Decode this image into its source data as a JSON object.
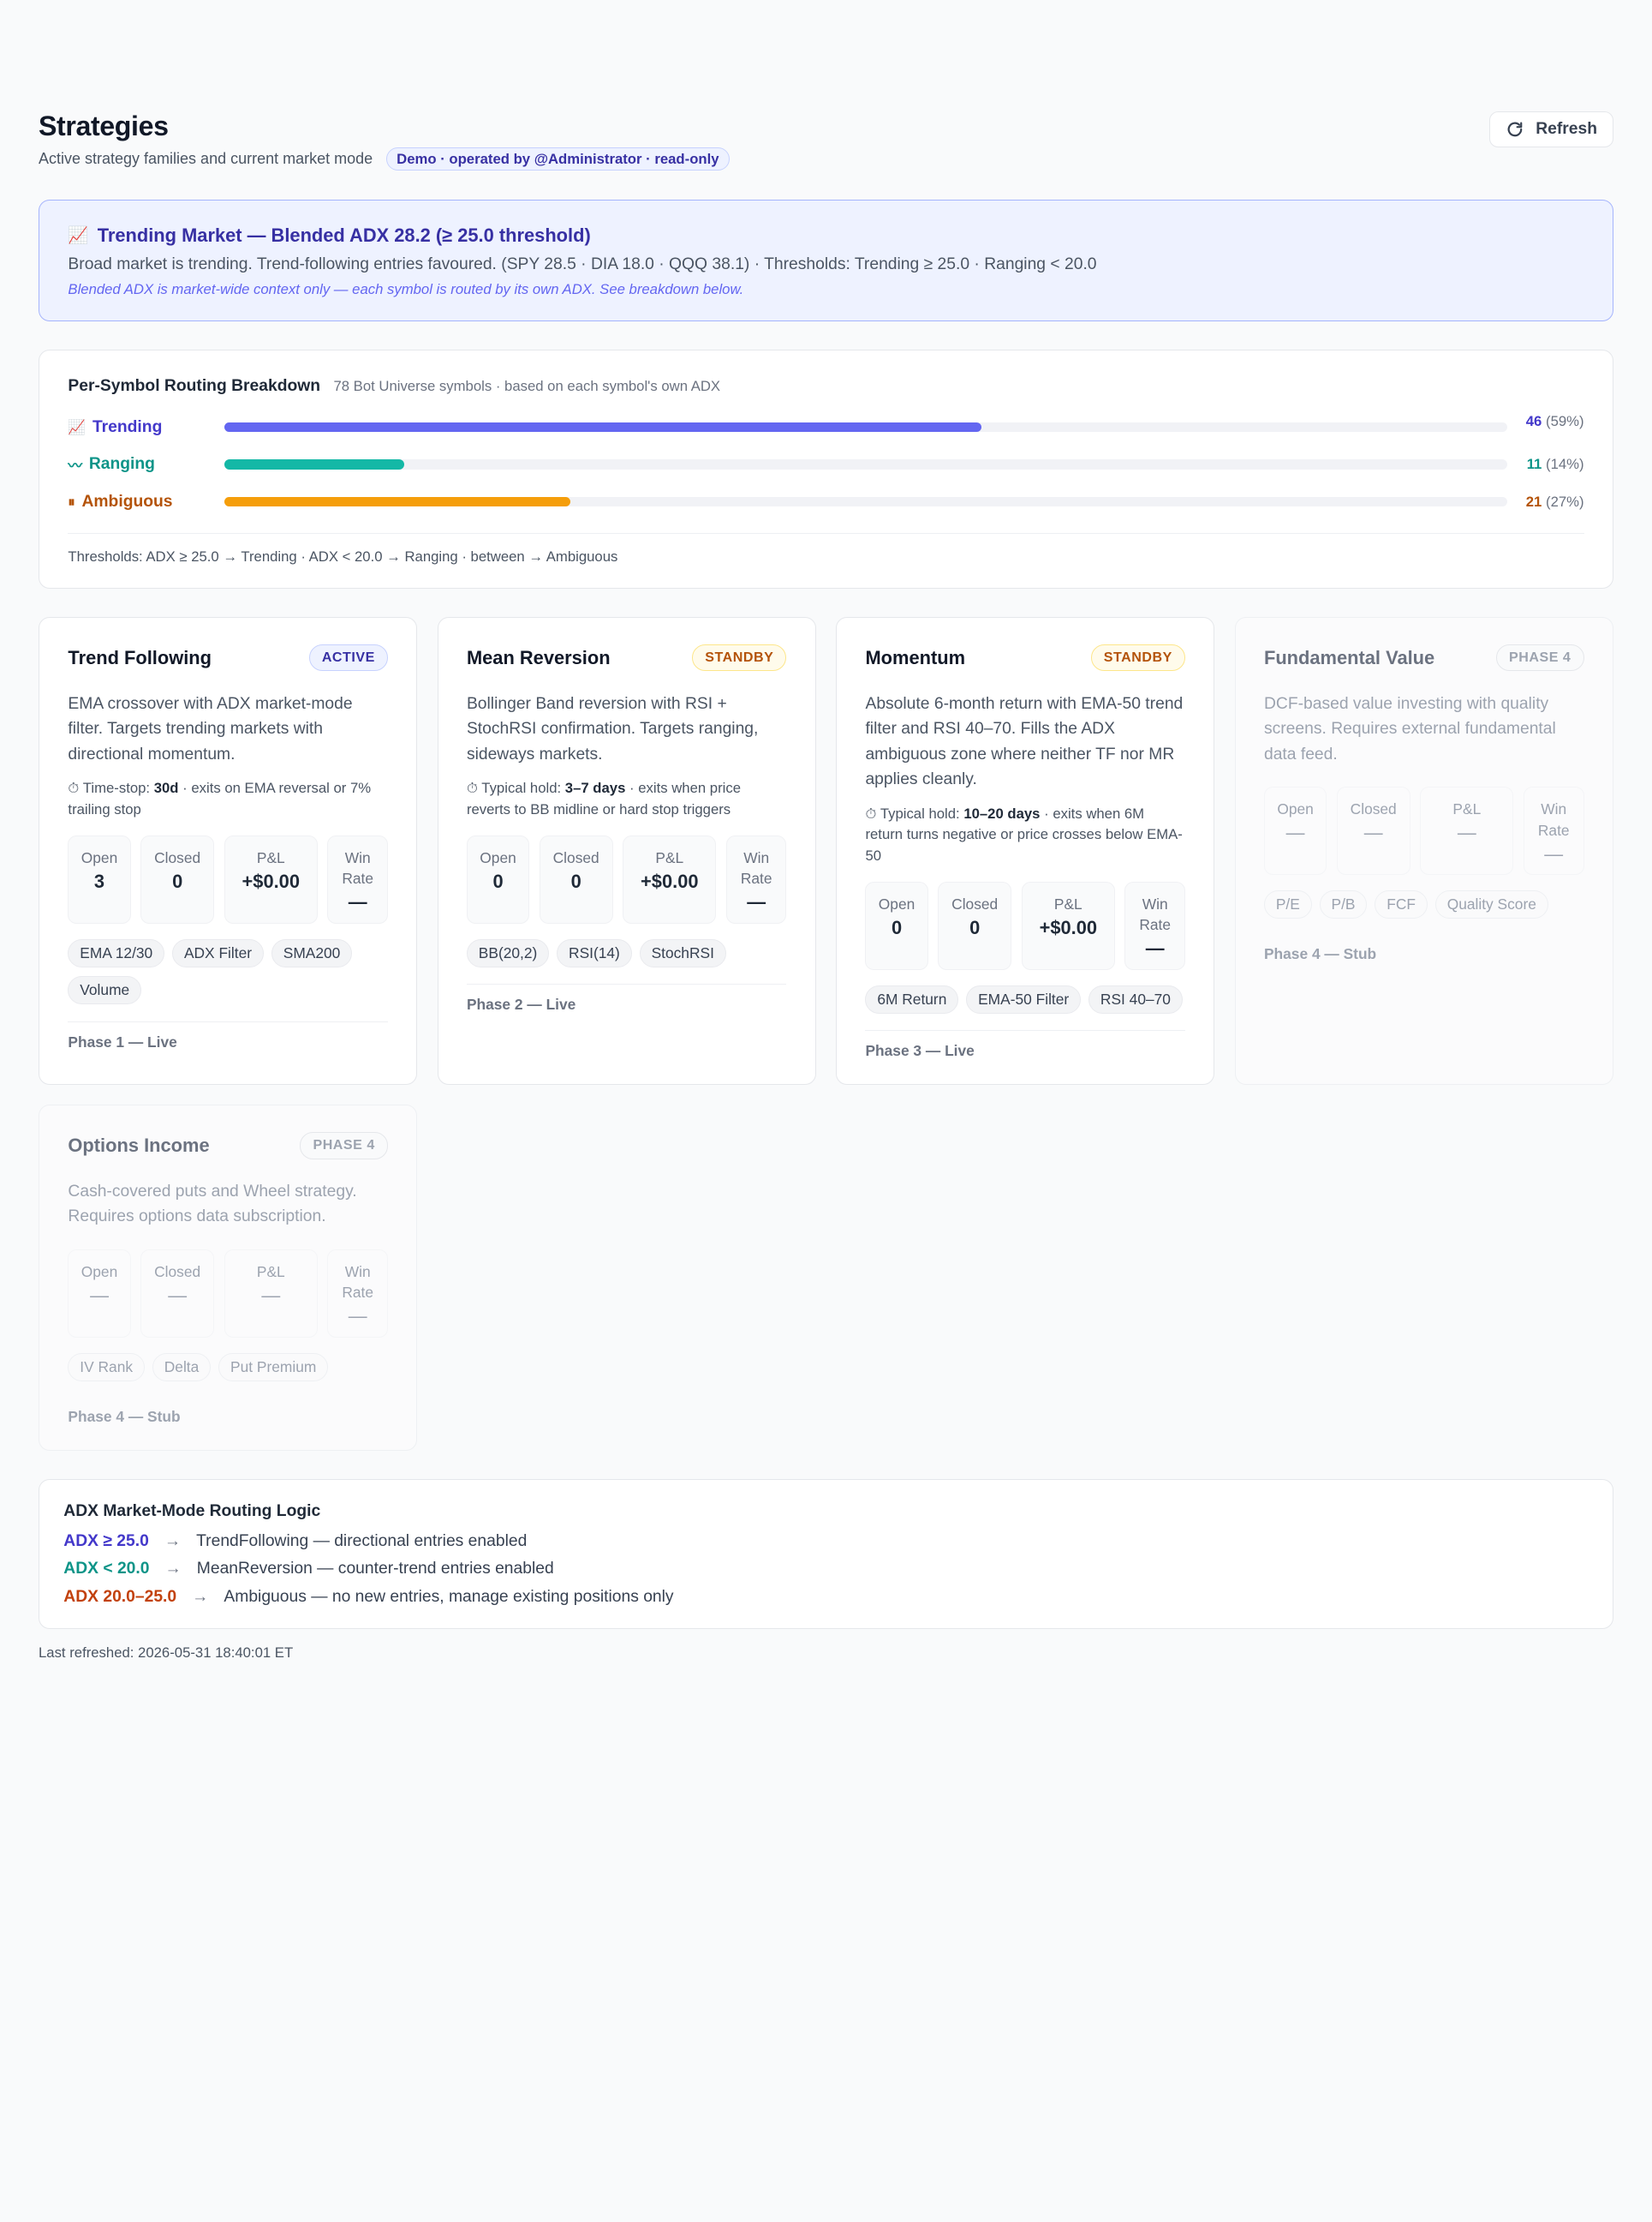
{
  "header": {
    "title": "Strategies",
    "subtitle": "Active strategy families and current market mode",
    "demo_badge": "Demo · operated by @Administrator · read-only",
    "refresh_label": "Refresh"
  },
  "market_banner": {
    "icon": "chart-increasing-icon",
    "title": "Trending Market — Blended ADX 28.2 (≥ 25.0 threshold)",
    "description": "Broad market is trending. Trend-following entries favoured. (SPY 28.5 · DIA 18.0 · QQQ 38.1) · Thresholds: Trending ≥ 25.0 · Ranging < 20.0",
    "note": "Blended ADX is market-wide context only — each symbol is routed by its own ADX. See breakdown below."
  },
  "breakdown": {
    "title": "Per-Symbol Routing Breakdown",
    "subtitle": "78 Bot Universe symbols · based on each symbol's own ADX",
    "rows": [
      {
        "icon": "📈",
        "label": "Trending",
        "count": "46",
        "pct": "(59%)",
        "fraction": 0.59,
        "color": "#6366f1",
        "label_color": "#4338ca"
      },
      {
        "icon": "〰",
        "label": "Ranging",
        "count": "11",
        "pct": "(14%)",
        "fraction": 0.14,
        "color": "#14b8a6",
        "label_color": "#0d9488"
      },
      {
        "icon": "⏸",
        "label": "Ambiguous",
        "count": "21",
        "pct": "(27%)",
        "fraction": 0.27,
        "color": "#f59e0b",
        "label_color": "#b45309"
      }
    ],
    "thresholds": "Thresholds: ADX ≥ 25.0 → Trending · ADX < 20.0 → Ranging · between → Ambiguous"
  },
  "stat_labels": {
    "open": "Open",
    "closed": "Closed",
    "pnl": "P&L",
    "win": "Win Rate"
  },
  "strategies": [
    {
      "name": "Trend Following",
      "badge": "ACTIVE",
      "description": "EMA crossover with ADX market-mode filter. Targets trending markets with directional momentum.",
      "hold_prefix": "⏱ Time-stop: ",
      "hold_value": "30d",
      "hold_suffix": " · exits on EMA reversal or 7% trailing stop",
      "open": "3",
      "closed": "0",
      "pnl": "+$0.00",
      "win": "—",
      "tags": [
        "EMA 12/30",
        "ADX Filter",
        "SMA200",
        "Volume"
      ],
      "phase": "Phase 1 — Live"
    },
    {
      "name": "Mean Reversion",
      "badge": "STANDBY",
      "description": "Bollinger Band reversion with RSI + StochRSI confirmation. Targets ranging, sideways markets.",
      "hold_prefix": "⏱ Typical hold: ",
      "hold_value": "3–7 days",
      "hold_suffix": " · exits when price reverts to BB midline or hard stop triggers",
      "open": "0",
      "closed": "0",
      "pnl": "+$0.00",
      "win": "—",
      "tags": [
        "BB(20,2)",
        "RSI(14)",
        "StochRSI"
      ],
      "phase": "Phase 2 — Live"
    },
    {
      "name": "Momentum",
      "badge": "STANDBY",
      "description": "Absolute 6-month return with EMA-50 trend filter and RSI 40–70. Fills the ADX ambiguous zone where neither TF nor MR applies cleanly.",
      "hold_prefix": "⏱ Typical hold: ",
      "hold_value": "10–20 days",
      "hold_suffix": " · exits when 6M return turns negative or price crosses below EMA-50",
      "open": "0",
      "closed": "0",
      "pnl": "+$0.00",
      "win": "—",
      "tags": [
        "6M Return",
        "EMA-50 Filter",
        "RSI 40–70"
      ],
      "phase": "Phase 3 — Live"
    },
    {
      "name": "Fundamental Value",
      "badge": "PHASE 4",
      "description": "DCF-based value investing with quality screens. Requires external fundamental data feed.",
      "open": "—",
      "closed": "—",
      "pnl": "—",
      "win": "—",
      "tags": [
        "P/E",
        "P/B",
        "FCF",
        "Quality Score"
      ],
      "phase": "Phase 4 — Stub"
    },
    {
      "name": "Options Income",
      "badge": "PHASE 4",
      "description": "Cash-covered puts and Wheel strategy. Requires options data subscription.",
      "open": "—",
      "closed": "—",
      "pnl": "—",
      "win": "—",
      "tags": [
        "IV Rank",
        "Delta",
        "Put Premium"
      ],
      "phase": "Phase 4 — Stub"
    }
  ],
  "logic": {
    "title": "ADX Market-Mode Routing Logic",
    "rows": [
      {
        "cond": "ADX ≥ 25.0",
        "arrow": "→",
        "text": "TrendFollowing — directional entries enabled",
        "color": "#4338ca"
      },
      {
        "cond": "ADX < 20.0",
        "arrow": "→",
        "text": "MeanReversion — counter-trend entries enabled",
        "color": "#0d9488"
      },
      {
        "cond": "ADX 20.0–25.0",
        "arrow": "→",
        "text": "Ambiguous — no new entries, manage existing positions only",
        "color": "#c2410c"
      }
    ]
  },
  "footer": {
    "last_refreshed": "Last refreshed: 2026-05-31 18:40:01 ET"
  }
}
